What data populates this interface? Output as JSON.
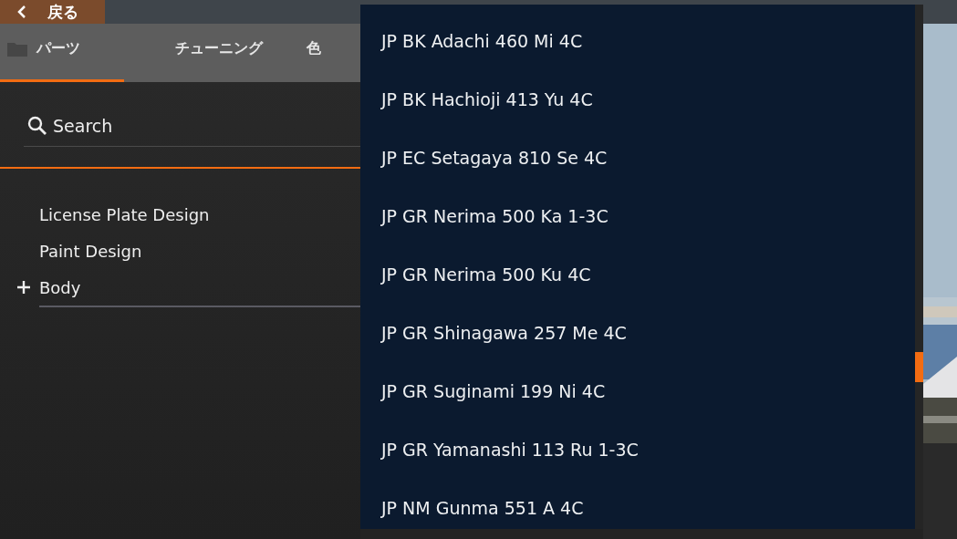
{
  "back_button": {
    "label": "戻る"
  },
  "tabs": [
    {
      "label": "パーツ",
      "selected": true,
      "kind": "folder"
    },
    {
      "label": "チューニング",
      "selected": false,
      "kind": "plain"
    },
    {
      "label": "色",
      "selected": false,
      "kind": "plain"
    }
  ],
  "search": {
    "placeholder": "Search"
  },
  "parts_tree": [
    {
      "label": "License Plate Design",
      "expandable": false
    },
    {
      "label": "Paint Design",
      "expandable": false
    },
    {
      "label": "Body",
      "expandable": true
    }
  ],
  "dropdown": {
    "items": [
      {
        "label": "JP BK Adachi 460 Mi 4C"
      },
      {
        "label": "JP BK Hachioji 413 Yu 4C"
      },
      {
        "label": "JP EC Setagaya 810 Se 4C"
      },
      {
        "label": "JP GR Nerima 500 Ka 1-3C"
      },
      {
        "label": "JP GR Nerima 500 Ku 4C"
      },
      {
        "label": "JP GR Shinagawa 257 Me 4C"
      },
      {
        "label": "JP GR Suginami 199 Ni 4C"
      },
      {
        "label": "JP GR Yamanashi 113 Ru 1-3C"
      },
      {
        "label": "JP NM Gunma 551 A 4C"
      }
    ]
  }
}
